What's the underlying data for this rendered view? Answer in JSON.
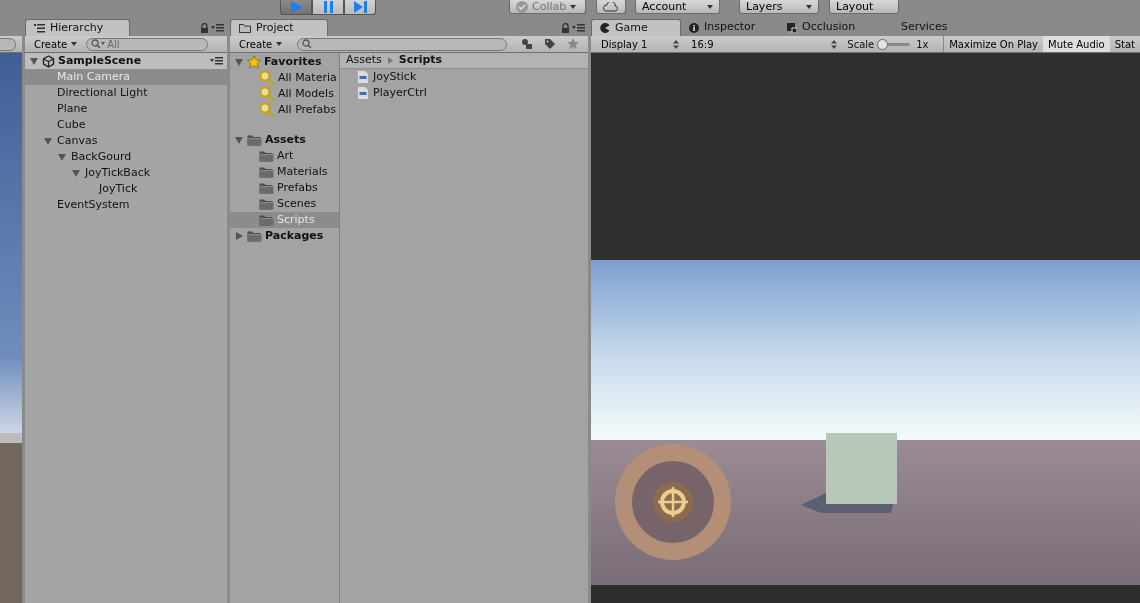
{
  "toolbar": {
    "transport": [
      {
        "kind": "play",
        "selected": true
      },
      {
        "kind": "pause",
        "selected": false
      },
      {
        "kind": "step",
        "selected": false
      }
    ],
    "collab": "Collab",
    "account": "Account",
    "layers": "Layers",
    "layout": "Layout"
  },
  "hierarchy": {
    "title": "Hierarchy",
    "create": "Create",
    "search_placeholder": "All",
    "scene": "SampleScene",
    "items": [
      {
        "label": "Main Camera",
        "selected": true
      },
      {
        "label": "Directional Light",
        "selected": false
      },
      {
        "label": "Plane",
        "selected": false
      },
      {
        "label": "Cube",
        "selected": false
      },
      {
        "label": "Canvas",
        "selected": false,
        "expanded": true,
        "children": [
          {
            "label": "BackGourd",
            "selected": false,
            "expanded": true,
            "children": [
              {
                "label": "JoyTickBack",
                "selected": false,
                "expanded": true,
                "children": [
                  {
                    "label": "JoyTick",
                    "selected": false
                  }
                ]
              }
            ]
          }
        ]
      },
      {
        "label": "EventSystem",
        "selected": false
      }
    ]
  },
  "project": {
    "title": "Project",
    "create": "Create",
    "groups": [
      {
        "label": "Favorites",
        "kind": "favorites",
        "expanded": true,
        "items": [
          {
            "label": "All Materia",
            "selected": false
          },
          {
            "label": "All Models",
            "selected": false
          },
          {
            "label": "All Prefabs",
            "selected": false
          }
        ]
      },
      {
        "label": "Assets",
        "kind": "folder",
        "expanded": true,
        "items": [
          {
            "label": "Art",
            "selected": false
          },
          {
            "label": "Materials",
            "selected": false
          },
          {
            "label": "Prefabs",
            "selected": false
          },
          {
            "label": "Scenes",
            "selected": false
          },
          {
            "label": "Scripts",
            "selected": true
          }
        ]
      },
      {
        "label": "Packages",
        "kind": "folder",
        "expanded": false
      }
    ],
    "breadcrumb": [
      "Assets",
      "Scripts"
    ],
    "files": [
      "JoyStick",
      "PlayerCtrl"
    ]
  },
  "game": {
    "tabs": [
      {
        "label": "Game",
        "kind": "game",
        "selected": true
      },
      {
        "label": "Inspector",
        "kind": "info",
        "selected": false
      },
      {
        "label": "Occlusion",
        "kind": "occlusion",
        "selected": false
      },
      {
        "label": "Services",
        "kind": "plain",
        "selected": false
      }
    ],
    "display": "Display 1",
    "aspect": "16:9",
    "scale_label": "Scale",
    "scale": {
      "level": 0.05
    },
    "scale_reading": "1x",
    "toggles": [
      {
        "label": "Maximize On Play",
        "on": false
      },
      {
        "label": "Mute Audio",
        "on": true
      },
      {
        "label": "Stat",
        "on": false
      }
    ]
  }
}
